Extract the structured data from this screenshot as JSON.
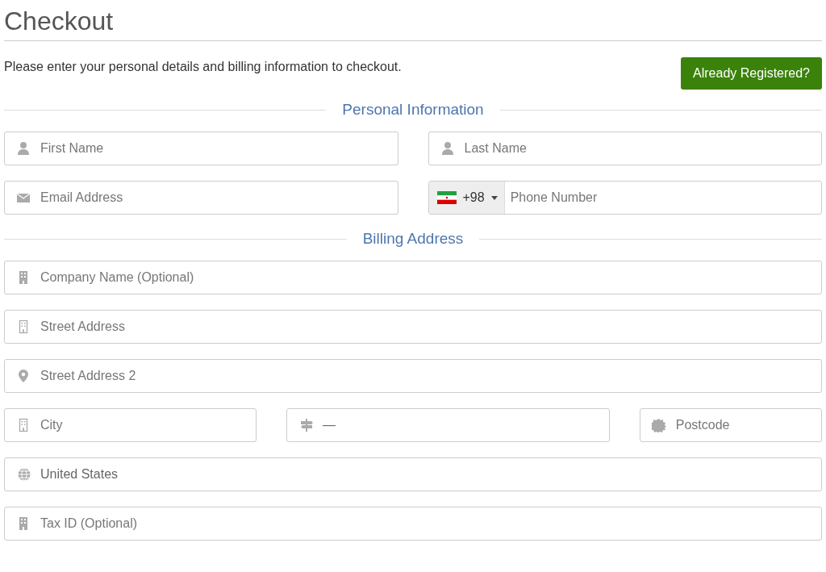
{
  "title": "Checkout",
  "intro": "Please enter your personal details and billing information to checkout.",
  "login_button": "Already Registered?",
  "sections": [
    {
      "heading": "Personal Information",
      "rows": [
        {
          "fields": [
            {
              "kind": "input",
              "placeholder": "First Name"
            },
            {
              "kind": "input",
              "placeholder": "Last Name"
            }
          ]
        },
        {
          "fields": [
            {
              "kind": "input",
              "placeholder": "Email Address"
            },
            {
              "kind": "phone",
              "country_code": "+98",
              "placeholder": "Phone Number"
            }
          ]
        }
      ]
    },
    {
      "heading": "Billing Address",
      "rows": [
        {
          "fields": [
            {
              "kind": "input",
              "placeholder": "Company Name (Optional)"
            }
          ]
        },
        {
          "fields": [
            {
              "kind": "input",
              "placeholder": "Street Address"
            }
          ]
        },
        {
          "fields": [
            {
              "kind": "input",
              "placeholder": "Street Address 2"
            }
          ]
        },
        {
          "fields": [
            {
              "kind": "input",
              "placeholder": "City"
            },
            {
              "kind": "select",
              "value": "—"
            },
            {
              "kind": "input",
              "placeholder": "Postcode"
            }
          ]
        },
        {
          "fields": [
            {
              "kind": "select",
              "value": "United States"
            }
          ]
        },
        {
          "fields": [
            {
              "kind": "input",
              "placeholder": "Tax ID (Optional)"
            }
          ]
        }
      ]
    }
  ]
}
